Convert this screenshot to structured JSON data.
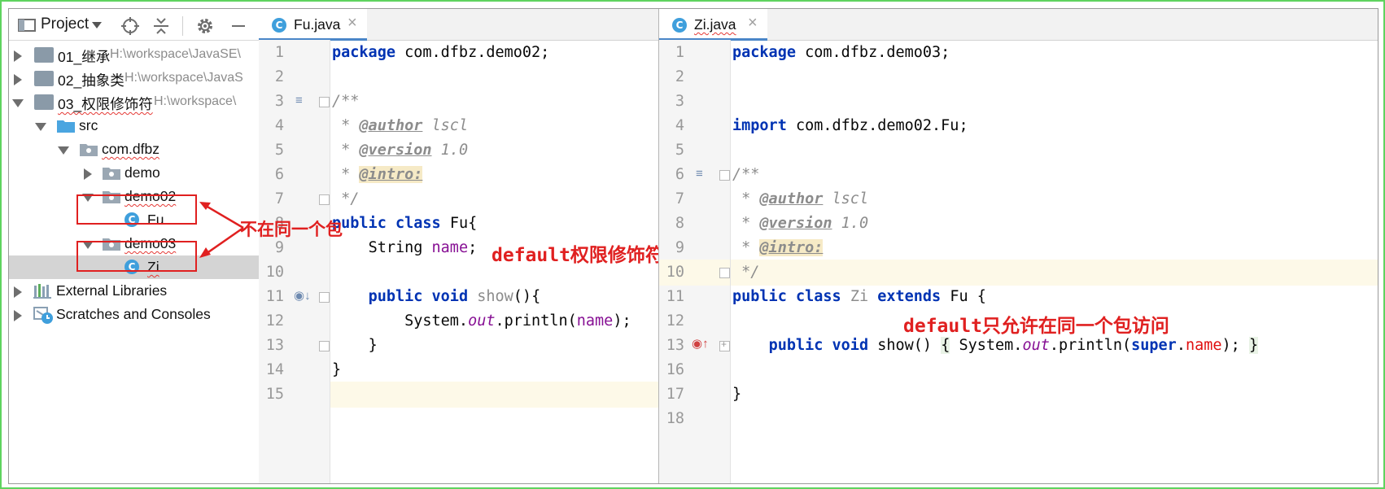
{
  "project_panel": {
    "title": "Project",
    "tree": [
      {
        "label": "01_继承",
        "path": "H:\\workspace\\JavaSE\\"
      },
      {
        "label": "02_抽象类",
        "path": "H:\\workspace\\JavaS"
      },
      {
        "label": "03_权限修饰符",
        "path": "H:\\workspace\\"
      },
      {
        "label": "src"
      },
      {
        "label": "com.dfbz"
      },
      {
        "label": "demo"
      },
      {
        "label": "demo02"
      },
      {
        "label": "Fu"
      },
      {
        "label": "demo03"
      },
      {
        "label": "Zi"
      },
      {
        "label": "External Libraries"
      },
      {
        "label": "Scratches and Consoles"
      }
    ],
    "class_badge": "C"
  },
  "annotations": {
    "not_same_package": "不在同一个包",
    "default_modifier": "default权限修饰符",
    "default_same_package_only": "default只允许在同一个包访问"
  },
  "editor_left": {
    "tab": {
      "label": "Fu.java",
      "badge": "C",
      "close": "×"
    },
    "line_numbers": [
      "1",
      "2",
      "3",
      "4",
      "5",
      "6",
      "7",
      "8",
      "9",
      "10",
      "11",
      "12",
      "13",
      "14",
      "15"
    ],
    "lines": {
      "l1": {
        "kw": "package",
        "rest": " com.dfbz.demo02;"
      },
      "l3": "/**",
      "l4": {
        "star": " * ",
        "tag": "@author",
        "rest": " lscl"
      },
      "l5": {
        "star": " * ",
        "tag": "@version",
        "rest": " 1.0"
      },
      "l6": {
        "star": " * ",
        "tag": "@intro:"
      },
      "l7": " */",
      "l8": {
        "kw1": "public",
        "kw2": "class",
        "name": "Fu",
        "brace": "{"
      },
      "l9": {
        "type": "String",
        "field": "name",
        "semi": ";"
      },
      "l11": {
        "kw1": "public",
        "kw2": "void",
        "name": "show",
        "rest": "(){"
      },
      "l12": {
        "cls": "System.",
        "static": "out",
        "call": ".println(",
        "field": "name",
        "end": ");"
      },
      "l13": "}",
      "l14": "}"
    }
  },
  "editor_right": {
    "tab": {
      "label": "Zi.java",
      "badge": "C",
      "close": "×"
    },
    "line_numbers": [
      "1",
      "2",
      "3",
      "4",
      "5",
      "6",
      "7",
      "8",
      "9",
      "10",
      "11",
      "12",
      "13",
      "16",
      "17",
      "18"
    ],
    "lines": {
      "l1": {
        "kw": "package",
        "rest": " com.dfbz.demo03;"
      },
      "l4": {
        "kw": "import",
        "rest": " com.dfbz.demo02.Fu;"
      },
      "l6": "/**",
      "l7": {
        "star": " * ",
        "tag": "@author",
        "rest": " lscl"
      },
      "l8": {
        "star": " * ",
        "tag": "@version",
        "rest": " 1.0"
      },
      "l9": {
        "star": " * ",
        "tag": "@intro:"
      },
      "l10": " */",
      "l11": {
        "kw1": "public",
        "kw2": "class",
        "name": "Zi",
        "kw3": "extends",
        "parent": "Fu",
        "brace": "{"
      },
      "l13": {
        "kw1": "public",
        "kw2": "void",
        "name": "show()",
        "open": "{",
        "cls": "System.",
        "static": "out",
        "call": ".println(",
        "super": "super",
        "dot": ".",
        "field": "name",
        "end": ");",
        "close": "}"
      },
      "l17": "}"
    }
  },
  "colors": {
    "keyword": "#0033b3",
    "annotation_red": "#e02020",
    "tab_underline": "#4a86c8"
  }
}
